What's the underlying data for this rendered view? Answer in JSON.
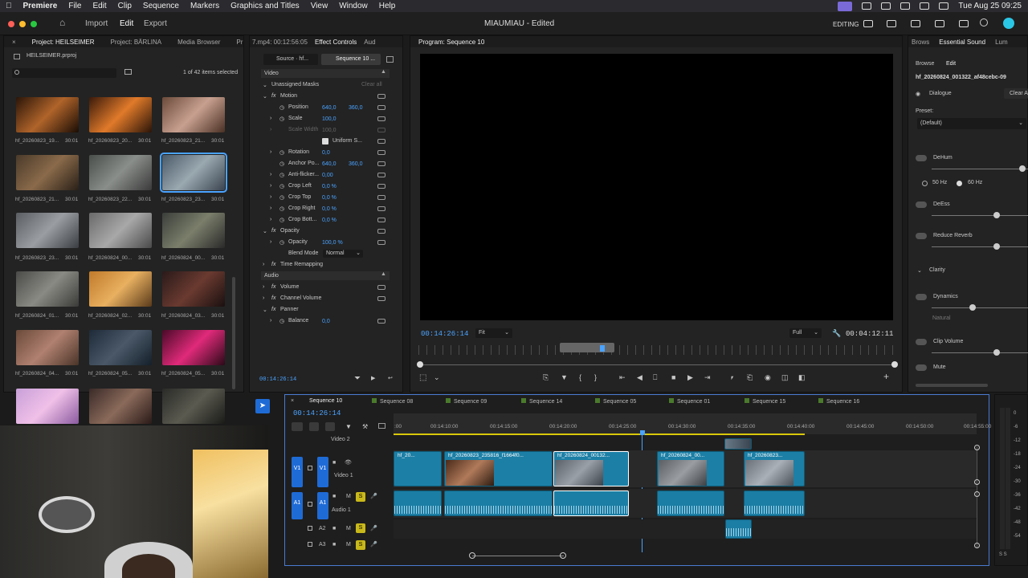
{
  "menubar": {
    "app": "Premiere",
    "items": [
      "File",
      "Edit",
      "Clip",
      "Sequence",
      "Markers",
      "Graphics and Titles",
      "View",
      "Window",
      "Help"
    ],
    "datetime": "Tue Aug 25  09:25"
  },
  "topbar": {
    "workspaces": {
      "import": "Import",
      "edit": "Edit",
      "export": "Export"
    },
    "title": "MIAUMIAU - Edited",
    "mode": "EDITING"
  },
  "project": {
    "tabs": [
      "Project: HEILSEIMER",
      "Project: BÄRLINA",
      "Media Browser",
      "Pr"
    ],
    "file": "HEILSEIMER.prproj",
    "selection": "1 of 42 items selected",
    "items": [
      {
        "name": "hf_20260823_19...",
        "dur": "30:01"
      },
      {
        "name": "hf_20260823_20...",
        "dur": "30:01"
      },
      {
        "name": "hf_20260823_21...",
        "dur": "30:01"
      },
      {
        "name": "hf_20260823_21...",
        "dur": "30:01"
      },
      {
        "name": "hf_20260823_22...",
        "dur": "30:01"
      },
      {
        "name": "hf_20260823_23...",
        "dur": "30:01"
      },
      {
        "name": "hf_20260823_23...",
        "dur": "30:01"
      },
      {
        "name": "hf_20260824_00...",
        "dur": "30:01"
      },
      {
        "name": "hf_20260824_00...",
        "dur": "30:01"
      },
      {
        "name": "hf_20260824_01...",
        "dur": "30:01"
      },
      {
        "name": "hf_20260824_02...",
        "dur": "30:01"
      },
      {
        "name": "hf_20260824_03...",
        "dur": "30:01"
      },
      {
        "name": "hf_20260824_04...",
        "dur": "30:01"
      },
      {
        "name": "hf_20260824_05...",
        "dur": "30:01"
      },
      {
        "name": "hf_20260824_05...",
        "dur": "30:01"
      }
    ]
  },
  "effects": {
    "tabs": [
      "7.mp4: 00:12:56:05",
      "Effect Controls",
      "Aud"
    ],
    "source": "Source · hf...",
    "sequence": "Sequence 10 ...",
    "video": "Video",
    "unassigned_masks": "Unassigned Masks",
    "clear_all": "Clear all",
    "motion": "Motion",
    "position": {
      "label": "Position",
      "x": "640,0",
      "y": "360,0"
    },
    "scale": {
      "label": "Scale",
      "value": "100,0"
    },
    "scale_width": {
      "label": "Scale Width",
      "value": "100,0"
    },
    "uniform": "Uniform S...",
    "rotation": {
      "label": "Rotation",
      "value": "0,0"
    },
    "anchor": {
      "label": "Anchor Po...",
      "x": "640,0",
      "y": "360,0"
    },
    "antiflicker": {
      "label": "Anti-flicker...",
      "value": "0,00"
    },
    "crop_left": {
      "label": "Crop Left",
      "value": "0,0 %"
    },
    "crop_top": {
      "label": "Crop Top",
      "value": "0,0 %"
    },
    "crop_right": {
      "label": "Crop Right",
      "value": "0,0 %"
    },
    "crop_bottom": {
      "label": "Crop Bott...",
      "value": "0,0 %"
    },
    "opacity_group": "Opacity",
    "opacity": {
      "label": "Opacity",
      "value": "100,0 %"
    },
    "blend": {
      "label": "Blend Mode",
      "value": "Normal"
    },
    "time_remap": "Time Remapping",
    "audio": "Audio",
    "volume": "Volume",
    "channel_volume": "Channel Volume",
    "panner": "Panner",
    "balance": {
      "label": "Balance",
      "value": "0,0"
    },
    "timecode": "00:14:26:14"
  },
  "program": {
    "title": "Program: Sequence 10",
    "timecode": "00:14:26:14",
    "fit": "Fit",
    "quality": "Full",
    "duration": "00:04:12:11"
  },
  "essential_sound": {
    "tabs": [
      "Brows",
      "Essential Sound",
      "Lum"
    ],
    "browse": "Browse",
    "edit": "Edit",
    "clip": "hf_20260824_001322_af48cebc-09",
    "type": "Dialogue",
    "clear": "Clear A",
    "preset_label": "Preset:",
    "preset": "(Default)",
    "dehum": "DeHum",
    "hz50": "50 Hz",
    "hz60": "60 Hz",
    "deess": "DeEss",
    "reverb": "Reduce Reverb",
    "clarity": "Clarity",
    "dynamics": "Dynamics",
    "natural": "Natural",
    "clip_volume": "Clip Volume",
    "mute": "Mute"
  },
  "timeline": {
    "tabs": [
      "Sequence 10",
      "Sequence 08",
      "Sequence 09",
      "Sequence 14",
      "Sequence 05",
      "Sequence 01",
      "Sequence 15",
      "Sequence 16"
    ],
    "timecode": "00:14:26:14",
    "ruler": [
      ":00",
      "00:14:10:00",
      "00:14:15:00",
      "00:14:20:00",
      "00:14:25:00",
      "00:14:30:00",
      "00:14:35:00",
      "00:14:40:00",
      "00:14:45:00",
      "00:14:50:00",
      "00:14:55:00"
    ],
    "video2": "Video 2",
    "video1": "Video 1",
    "audio1": "Audio 1",
    "v1": "V1",
    "a1": "A1",
    "a2": "A2",
    "a3": "A3",
    "m": "M",
    "s": "S",
    "clips": [
      "hf_20...",
      "hf_20260823_235816_f1664f0...",
      "hf_20260824_00132...",
      "hf_20260824_00...",
      "hf_20260823..."
    ]
  },
  "meter": {
    "labels": [
      "0",
      "-6",
      "-12",
      "-18",
      "-24",
      "-30",
      "-36",
      "-42",
      "-48",
      "-54"
    ],
    "foot": "S S"
  }
}
